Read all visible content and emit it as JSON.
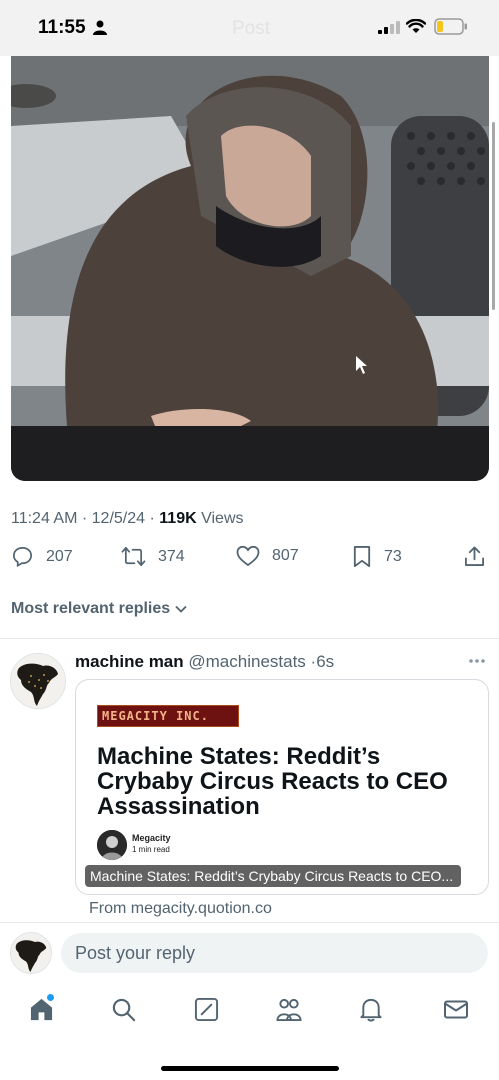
{
  "status": {
    "time": "11:55",
    "ghost_title": "Post"
  },
  "tweet": {
    "time": "11:24 AM",
    "date": "12/5/24",
    "views_count": "119K",
    "views_label": "Views",
    "stats": {
      "replies": "207",
      "reposts": "374",
      "likes": "807",
      "bookmarks": "73"
    }
  },
  "replies_sort": "Most relevant replies",
  "reply": {
    "display_name": "machine man",
    "handle": "@machinestats",
    "sep": "·",
    "time_ago": "6s",
    "card": {
      "logo_text": "MEGACITY INC.",
      "headline": "Machine States: Reddit’s Crybaby Circus Reacts to CEO Assassination",
      "author": "Megacity",
      "read_time": "1 min read",
      "overlay": "Machine States: Reddit’s Crybaby Circus Reacts to CEO...",
      "source": "From megacity.quotion.co"
    }
  },
  "compose": {
    "placeholder": "Post your reply"
  },
  "colors": {
    "accent": "#1d9bf0",
    "secondary_text": "#536471",
    "primary_text": "#0f1419"
  },
  "icons": [
    "reply-icon",
    "repost-icon",
    "like-icon",
    "bookmark-icon",
    "share-icon",
    "more-icon",
    "home-icon",
    "search-icon",
    "grok-icon",
    "communities-icon",
    "notifications-icon",
    "messages-icon"
  ]
}
